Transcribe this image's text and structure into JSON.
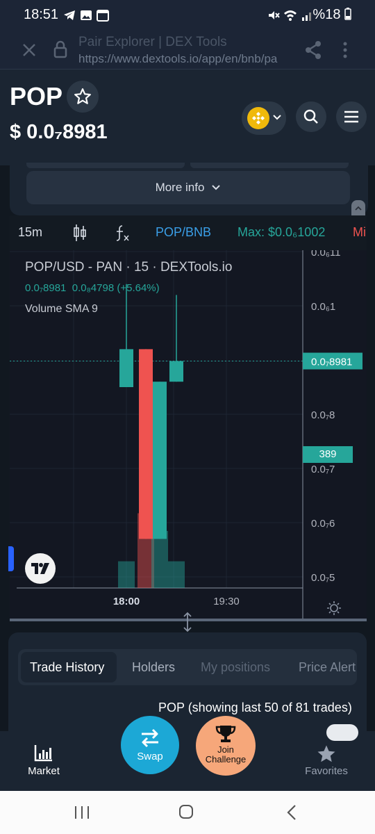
{
  "status_bar": {
    "time": "18:51",
    "battery": "%18"
  },
  "browser": {
    "page_title": "Pair Explorer | DEX Tools",
    "url": "https://www.dextools.io/app/en/bnb/pa"
  },
  "token": {
    "symbol": "POP",
    "price": "$ 0.0₇8981"
  },
  "more_info_label": "More info",
  "chart_toolbar": {
    "interval": "15m",
    "pair": "POP/BNB",
    "max_label": "Max: $0.0₆1002",
    "min_label": "Mi"
  },
  "chart": {
    "legend_title": "POP/USD - PAN · 15 · DEXTools.io",
    "legend_price": "0.0₇8981",
    "legend_change": "0.0₈4798 (+5.64%)",
    "indicator": "Volume SMA 9",
    "last_price_label": "0.0₇8981",
    "volume_label": "389",
    "time_labels": [
      "18:00",
      "19:30"
    ]
  },
  "chart_data": {
    "type": "candlestick",
    "yticks": [
      "0.0₆11",
      "0.0₆1",
      "0.0₇8981",
      "0.0₇8",
      "0.0₇7",
      "0.0₇6",
      "0.0₇5"
    ],
    "ytick_values": [
      1.1e-07,
      1e-07,
      8.981e-08,
      8e-08,
      7e-08,
      6e-08,
      5e-08
    ],
    "ylim": [
      4.9e-08,
      1.12e-07
    ],
    "candles": [
      {
        "open": 8.5e-08,
        "close": 9.2e-08,
        "high": 1.04e-07,
        "low": 8.5e-08,
        "color": "#26a69a",
        "volume": 0.4
      },
      {
        "open": 9.2e-08,
        "close": 5.7e-08,
        "high": 9.2e-08,
        "low": 5.7e-08,
        "color": "#ef5350",
        "volume": 1.0
      },
      {
        "open": 5.7e-08,
        "close": 8.6e-08,
        "high": 8.6e-08,
        "low": 5.7e-08,
        "color": "#26a69a",
        "volume": 0.9
      },
      {
        "open": 8.6e-08,
        "close": 8.981e-08,
        "high": 1.02e-07,
        "low": 8.6e-08,
        "color": "#26a69a",
        "volume": 0.4
      }
    ],
    "colors": {
      "up": "#26a69a",
      "down": "#ef5350"
    }
  },
  "trade_panel": {
    "tabs": [
      "Trade History",
      "Holders",
      "My positions",
      "Price Alert"
    ],
    "active_tab": "Trade History",
    "summary": "POP (showing last 50 of 81 trades)"
  },
  "bottom_nav": {
    "market": "Market",
    "swap": "Swap",
    "challenge_line1": "Join",
    "challenge_line2": "Challenge",
    "favorites": "Favorites"
  }
}
